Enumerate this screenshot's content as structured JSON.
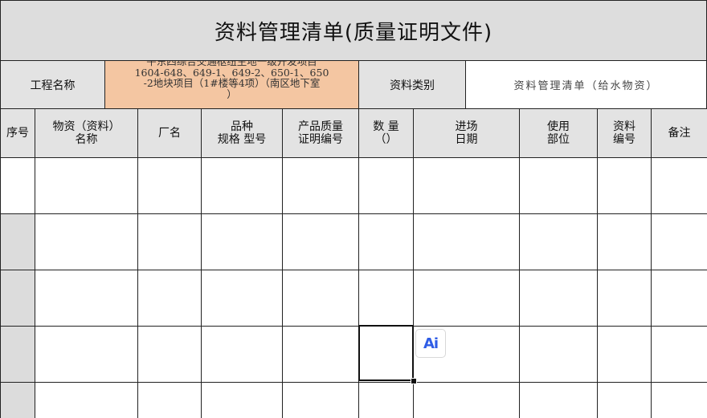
{
  "sheet": {
    "title": "资料管理清单(质量证明文件)",
    "project_label": "工程名称",
    "project_value": "平东四综合交通枢纽主地一级开发项目\n1604-648、649-1、649-2、650-1、650\n-2地块项目（1#楼等4项）（南区地下室\n）",
    "category_label": "资料类别",
    "category_value": "资料管理清单（给水物资）",
    "columns": [
      {
        "line1": "序号",
        "line2": ""
      },
      {
        "line1": "物资（资料）",
        "line2": "名称"
      },
      {
        "line1": "厂名",
        "line2": ""
      },
      {
        "line1": "品种",
        "line2": "规格 型号"
      },
      {
        "line1": "产品质量",
        "line2": "证明编号"
      },
      {
        "line1": "数 量",
        "line2": "（）"
      },
      {
        "line1": "进场",
        "line2": "日期"
      },
      {
        "line1": "使用",
        "line2": "部位"
      },
      {
        "line1": "资料",
        "line2": "编号"
      },
      {
        "line1": "备注",
        "line2": ""
      }
    ],
    "row_count": 5
  },
  "overlay": {
    "ai_icon": "ai-assistant-icon",
    "ai_label": "Ai"
  },
  "colors": {
    "title_bg": "#dddddd",
    "header_bg": "#e3e3e3",
    "project_bg": "#f4c6a2",
    "ai_accent": "#2f5de6"
  }
}
